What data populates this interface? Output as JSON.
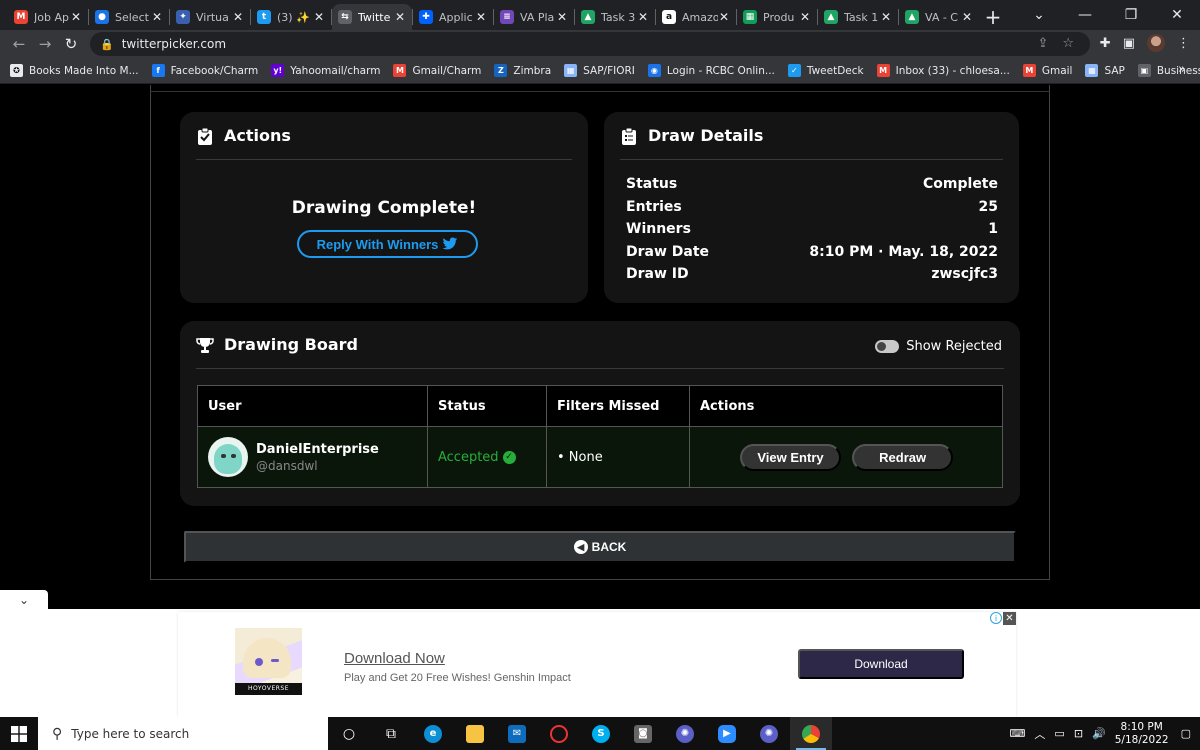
{
  "browser": {
    "tabs": [
      {
        "title": "Job Ap",
        "icon": "gmail-icon",
        "color": "#ea4335",
        "glyph": "M"
      },
      {
        "title": "Select",
        "icon": "blue-circle-icon",
        "color": "#1a73e8",
        "glyph": "●"
      },
      {
        "title": "Virtua",
        "icon": "virtual-icon",
        "color": "#3b5fb0",
        "glyph": "✦"
      },
      {
        "title": "(3) ✨",
        "icon": "twitter-icon",
        "color": "#1d9bf0",
        "glyph": "t"
      },
      {
        "title": "Twitte",
        "icon": "picker-icon",
        "color": "#5f6368",
        "glyph": "⇆",
        "active": true
      },
      {
        "title": "Applic",
        "icon": "dropbox-icon",
        "color": "#0061fe",
        "glyph": "✚"
      },
      {
        "title": "VA Pla",
        "icon": "forms-icon",
        "color": "#7248b9",
        "glyph": "≡"
      },
      {
        "title": "Task 3",
        "icon": "drive-icon",
        "color": "#1fa463",
        "glyph": "▲"
      },
      {
        "title": "Amazo",
        "icon": "amazon-icon",
        "color": "#ffffff",
        "glyph": "a"
      },
      {
        "title": "Produ",
        "icon": "sheets-icon",
        "color": "#0f9d58",
        "glyph": "▦"
      },
      {
        "title": "Task 1",
        "icon": "drive-icon",
        "color": "#1fa463",
        "glyph": "▲"
      },
      {
        "title": "VA - C",
        "icon": "drive-icon",
        "color": "#1fa463",
        "glyph": "▲"
      }
    ],
    "url": "twitterpicker.com",
    "bookmarks": [
      {
        "label": "Books Made Into M...",
        "color": "#e8eaed",
        "glyph": "✪"
      },
      {
        "label": "Facebook/Charm",
        "color": "#1877f2",
        "glyph": "f"
      },
      {
        "label": "Yahoomail/charm",
        "color": "#6001d2",
        "glyph": "y!"
      },
      {
        "label": "Gmail/Charm",
        "color": "#ea4335",
        "glyph": "M"
      },
      {
        "label": "Zimbra",
        "color": "#1565c0",
        "glyph": "Z"
      },
      {
        "label": "SAP/FIORI",
        "color": "#8ab4f8",
        "glyph": "▦"
      },
      {
        "label": "Login - RCBC Onlin...",
        "color": "#1a73e8",
        "glyph": "◉"
      },
      {
        "label": "TweetDeck",
        "color": "#1d9bf0",
        "glyph": "✓"
      },
      {
        "label": "Inbox (33) - chloesa...",
        "color": "#ea4335",
        "glyph": "M"
      },
      {
        "label": "Gmail",
        "color": "#ea4335",
        "glyph": "M"
      },
      {
        "label": "SAP",
        "color": "#8ab4f8",
        "glyph": "▦"
      },
      {
        "label": "Business Manager",
        "color": "#5f6368",
        "glyph": "▣"
      }
    ]
  },
  "actions": {
    "title": "Actions",
    "complete_text": "Drawing Complete!",
    "reply_label": "Reply With Winners"
  },
  "details": {
    "title": "Draw Details",
    "rows": [
      {
        "label": "Status",
        "value": "Complete"
      },
      {
        "label": "Entries",
        "value": "25"
      },
      {
        "label": "Winners",
        "value": "1"
      },
      {
        "label": "Draw Date",
        "value": "8:10 PM · May. 18, 2022"
      },
      {
        "label": "Draw ID",
        "value": "zwscjfc3"
      }
    ]
  },
  "board": {
    "title": "Drawing Board",
    "toggle_label": "Show Rejected",
    "toggle_on": false,
    "columns": [
      "User",
      "Status",
      "Filters Missed",
      "Actions"
    ],
    "rows": [
      {
        "name": "DanielEnterprise",
        "handle": "@dansdwl",
        "status": "Accepted",
        "filters": "• None",
        "view_label": "View Entry",
        "redraw_label": "Redraw"
      }
    ]
  },
  "back_label": "BACK",
  "ad": {
    "title": "Download Now",
    "subtitle": "Play and Get 20 Free Wishes! Genshin Impact",
    "button": "Download",
    "image_brand": "HOYOVERSE"
  },
  "taskbar": {
    "search_placeholder": "Type here to search",
    "time": "8:10 PM",
    "date": "5/18/2022"
  }
}
